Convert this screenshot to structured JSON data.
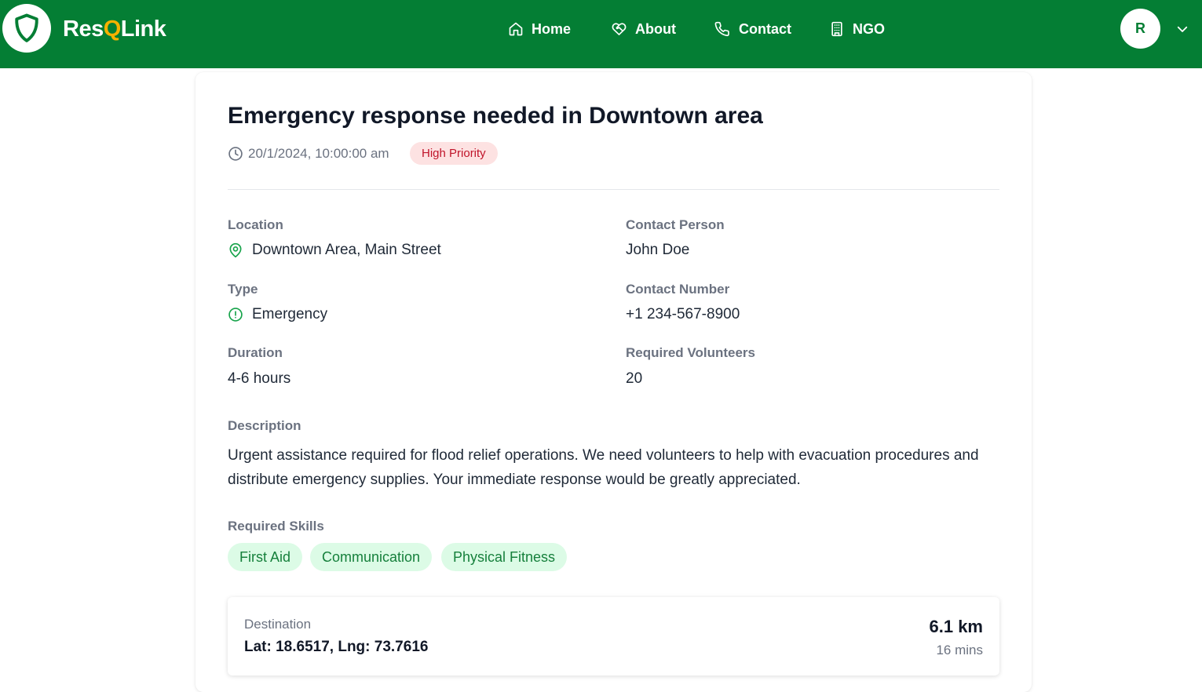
{
  "header": {
    "brand_prefix": "Res",
    "brand_q": "Q",
    "brand_suffix": "Link",
    "nav": [
      {
        "label": "Home",
        "icon": "home-icon"
      },
      {
        "label": "About",
        "icon": "heart-handshake-icon"
      },
      {
        "label": "Contact",
        "icon": "phone-icon"
      },
      {
        "label": "NGO",
        "icon": "building-icon"
      }
    ],
    "avatar_initial": "R"
  },
  "request": {
    "title": "Emergency response needed in Downtown area",
    "datetime": "20/1/2024, 10:00:00 am",
    "priority": "High Priority",
    "fields": {
      "location": {
        "label": "Location",
        "value": "Downtown Area, Main Street"
      },
      "contact_person": {
        "label": "Contact Person",
        "value": "John Doe"
      },
      "type": {
        "label": "Type",
        "value": "Emergency"
      },
      "contact_number": {
        "label": "Contact Number",
        "value": "+1 234-567-8900"
      },
      "duration": {
        "label": "Duration",
        "value": "4-6 hours"
      },
      "required_volunteers": {
        "label": "Required Volunteers",
        "value": "20"
      }
    },
    "description_label": "Description",
    "description": "Urgent assistance required for flood relief operations. We need volunteers to help with evacuation procedures and distribute emergency supplies. Your immediate response would be greatly appreciated.",
    "skills_label": "Required Skills",
    "skills": [
      "First Aid",
      "Communication",
      "Physical Fitness"
    ]
  },
  "destination": {
    "label": "Destination",
    "coords": "Lat: 18.6517, Lng: 73.7616",
    "distance": "6.1 km",
    "time": "16 mins"
  },
  "colors": {
    "header_green": "#047e34",
    "brand_accent": "#f5b100",
    "priority_bg": "#fde2e2",
    "priority_text": "#c0142a",
    "skill_bg": "#dcfbe6",
    "skill_text": "#16803c"
  }
}
